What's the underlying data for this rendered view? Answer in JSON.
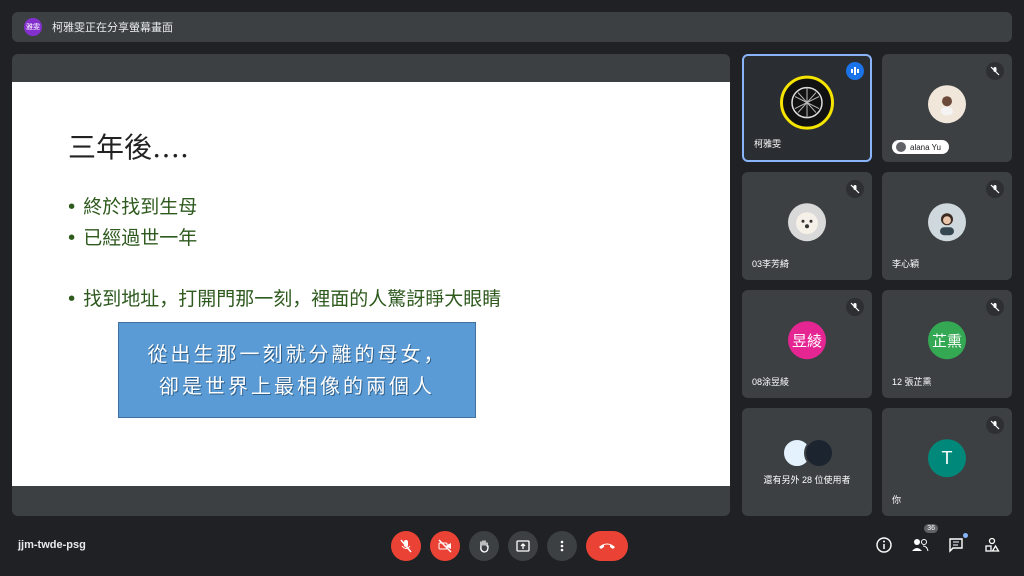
{
  "top_banner": {
    "avatar_text": "雅雯",
    "text": "柯雅雯正在分享螢幕畫面"
  },
  "slide": {
    "title": "三年後….",
    "bullets": [
      "終於找到生母",
      "已經過世一年",
      "找到地址，打開門那一刻，裡面的人驚訝睜大眼睛"
    ],
    "callout_lines": [
      "從出生那一刻就分離的母女，",
      "卻是世界上最相像的兩個人"
    ]
  },
  "participants": [
    {
      "name": "柯雅雯",
      "avatar_kind": "photo",
      "speaking": true
    },
    {
      "name": "alana Yu",
      "avatar_kind": "photo",
      "muted": true
    },
    {
      "name": "03李芳綺",
      "avatar_kind": "photo",
      "muted": true
    },
    {
      "name": "李心穎",
      "avatar_kind": "photo",
      "muted": true
    },
    {
      "name": "08涂昱綾",
      "avatar_text": "昱綾",
      "avatar_color": "#e52592",
      "muted": true
    },
    {
      "name": "12 張芷熏",
      "avatar_text": "芷熏",
      "avatar_color": "#34a853",
      "muted": true
    },
    {
      "name": "還有另外 28 位使用者",
      "avatar_kind": "group"
    },
    {
      "name": "你",
      "avatar_text": "T",
      "avatar_color": "#00897b",
      "muted": true
    }
  ],
  "bottom": {
    "meeting_code": "jjm-twde-psg",
    "people_count": "36",
    "icons": [
      "mic-off-icon",
      "camera-off-icon",
      "raise-hand-icon",
      "present-icon",
      "more-icon",
      "end-call-icon",
      "info-icon",
      "people-icon",
      "chat-icon",
      "activities-icon"
    ]
  },
  "colors": {
    "background": "#202124",
    "tile": "#3c4043",
    "danger": "#ea4335",
    "accent": "#8ab4f8",
    "slide_text": "#2e5a1e",
    "callout": "#5b9bd5"
  }
}
